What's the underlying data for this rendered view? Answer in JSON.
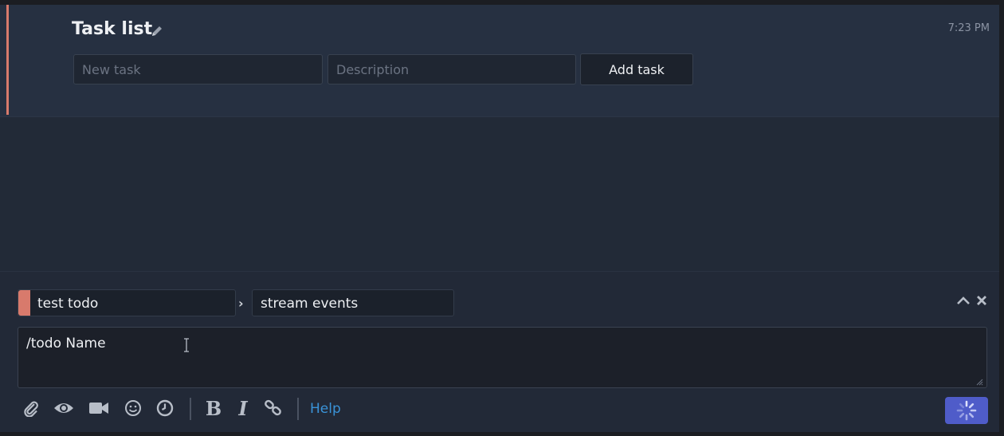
{
  "message": {
    "title": "Task list",
    "timestamp": "7:23 PM",
    "new_task_placeholder": "New task",
    "description_placeholder": "Description",
    "add_task_label": "Add task"
  },
  "compose": {
    "stream": "test todo",
    "topic": "stream events",
    "content": "/todo Name",
    "help_label": "Help",
    "stream_color": "#d87a6c",
    "send_color": "#4f5cc9"
  },
  "toolbar_icons": [
    "paperclip-icon",
    "eye-icon",
    "video-icon",
    "smiley-icon",
    "clock-icon",
    "bold-icon",
    "italic-icon",
    "link-icon"
  ]
}
